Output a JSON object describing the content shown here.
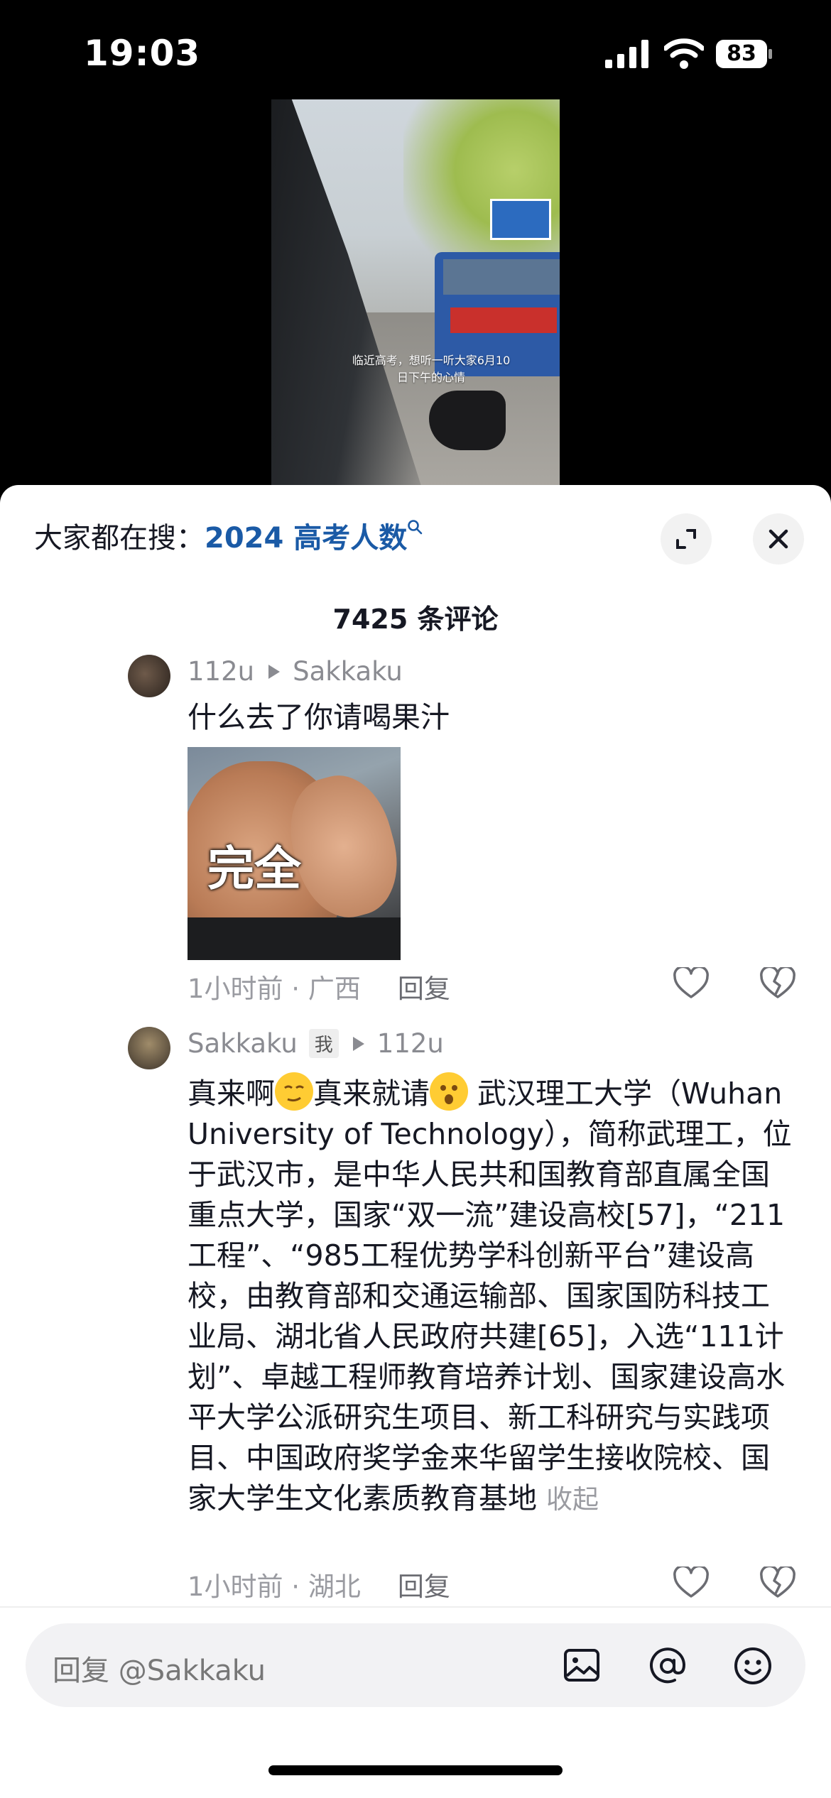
{
  "status_bar": {
    "time": "19:03",
    "battery": "83"
  },
  "video": {
    "caption_line1": "临近高考，想听一听大家6月10",
    "caption_line2": "日下午的心情"
  },
  "search_hint": {
    "prefix": "大家都在搜：",
    "keyword": "2024 高考人数"
  },
  "comments_count": "7425 条评论",
  "comments": [
    {
      "author": "112u",
      "reply_to": "Sakkaku",
      "text": "什么去了你请喝果汁",
      "sticker_text": "完全",
      "time_location": "1小时前 · 广西",
      "reply_label": "回复"
    },
    {
      "author": "Sakkaku",
      "me_tag": "我",
      "reply_to": "112u",
      "text_a": "真来啊",
      "text_b": "真来就请",
      "text_c": " 武汉理工大学（Wuhan University of Technology），简称武理工，位于武汉市，是中华人民共和国教育部直属全国重点大学，国家“双一流”建设高校[57]，“211工程”、“985工程优势学科创新平台”建设高校，由教育部和交通运输部、国家国防科技工业局、湖北省人民政府共建[65]，入选“111计划”、卓越工程师教育培养计划、国家建设高水平大学公派研究生项目、新工科研究与实践项目、中国政府奖学金来华留学生接收院校、国家大学生文化素质教育基地",
      "collapse_label": "收起",
      "time_location": "1小时前 · 湖北",
      "reply_label": "回复"
    }
  ],
  "input": {
    "placeholder": "回复 @Sakkaku"
  },
  "icons": {
    "expand": "expand-icon",
    "close": "close-icon",
    "heart": "heart-icon",
    "dislike": "broken-heart-icon",
    "image": "image-icon",
    "mention": "at-icon",
    "emoji": "emoji-icon"
  },
  "colors": {
    "keyword": "#1a5aa6",
    "meta": "#8a8b91"
  }
}
